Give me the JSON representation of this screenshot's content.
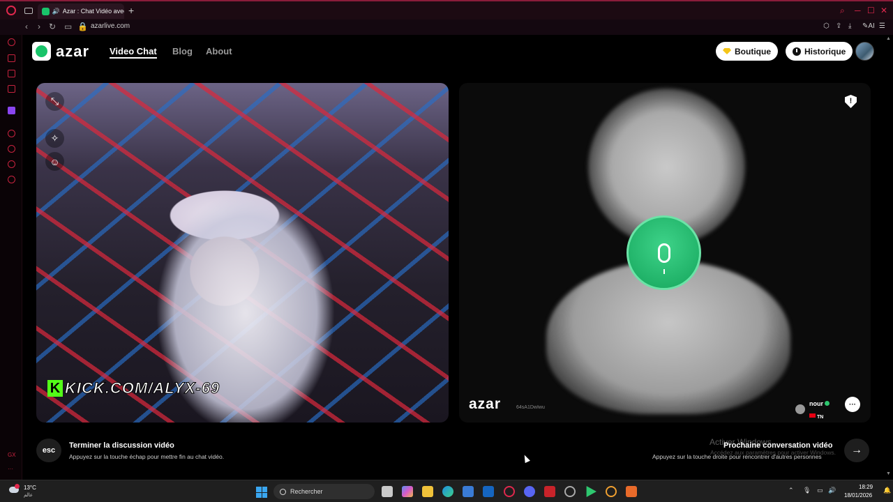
{
  "browser": {
    "tab_title": "Azar : Chat Vidéo avec",
    "new_tab": "+",
    "url": "azarlive.com",
    "ai_label": "AI"
  },
  "site": {
    "logo_text": "azar",
    "nav": [
      {
        "label": "Video Chat",
        "active": true
      },
      {
        "label": "Blog",
        "active": false
      },
      {
        "label": "About",
        "active": false
      }
    ],
    "shop_button": "Boutique",
    "history_button": "Historique"
  },
  "local_video": {
    "overlay_text": "KICK.COM/ALYX-69",
    "overlay_k": "K"
  },
  "remote_video": {
    "brand": "azar",
    "session_id": "64sA1DwIwu",
    "peer_name": "nour",
    "peer_country": "TN",
    "report_icon": "!"
  },
  "actions": {
    "end_key": "esc",
    "end_title": "Terminer la discussion vidéo",
    "end_sub": "Appuyez sur la touche échap pour mettre fin au chat vidéo.",
    "next_title": "Prochaine conversation vidéo",
    "next_sub": "Appuyez sur la touche droite pour rencontrer d'autres personnes",
    "next_arrow": "→"
  },
  "watermark": {
    "line1": "Activer Windows",
    "line2": "Accédez aux paramètres pour activer Windows."
  },
  "taskbar": {
    "temperature": "13°C",
    "location": "عالم",
    "search_placeholder": "Rechercher",
    "time": "18:29",
    "date": "18/01/2026"
  },
  "colors": {
    "brand_green": "#19c46a",
    "opera_red": "#e0284d",
    "mic_green": "#2cc47a"
  }
}
